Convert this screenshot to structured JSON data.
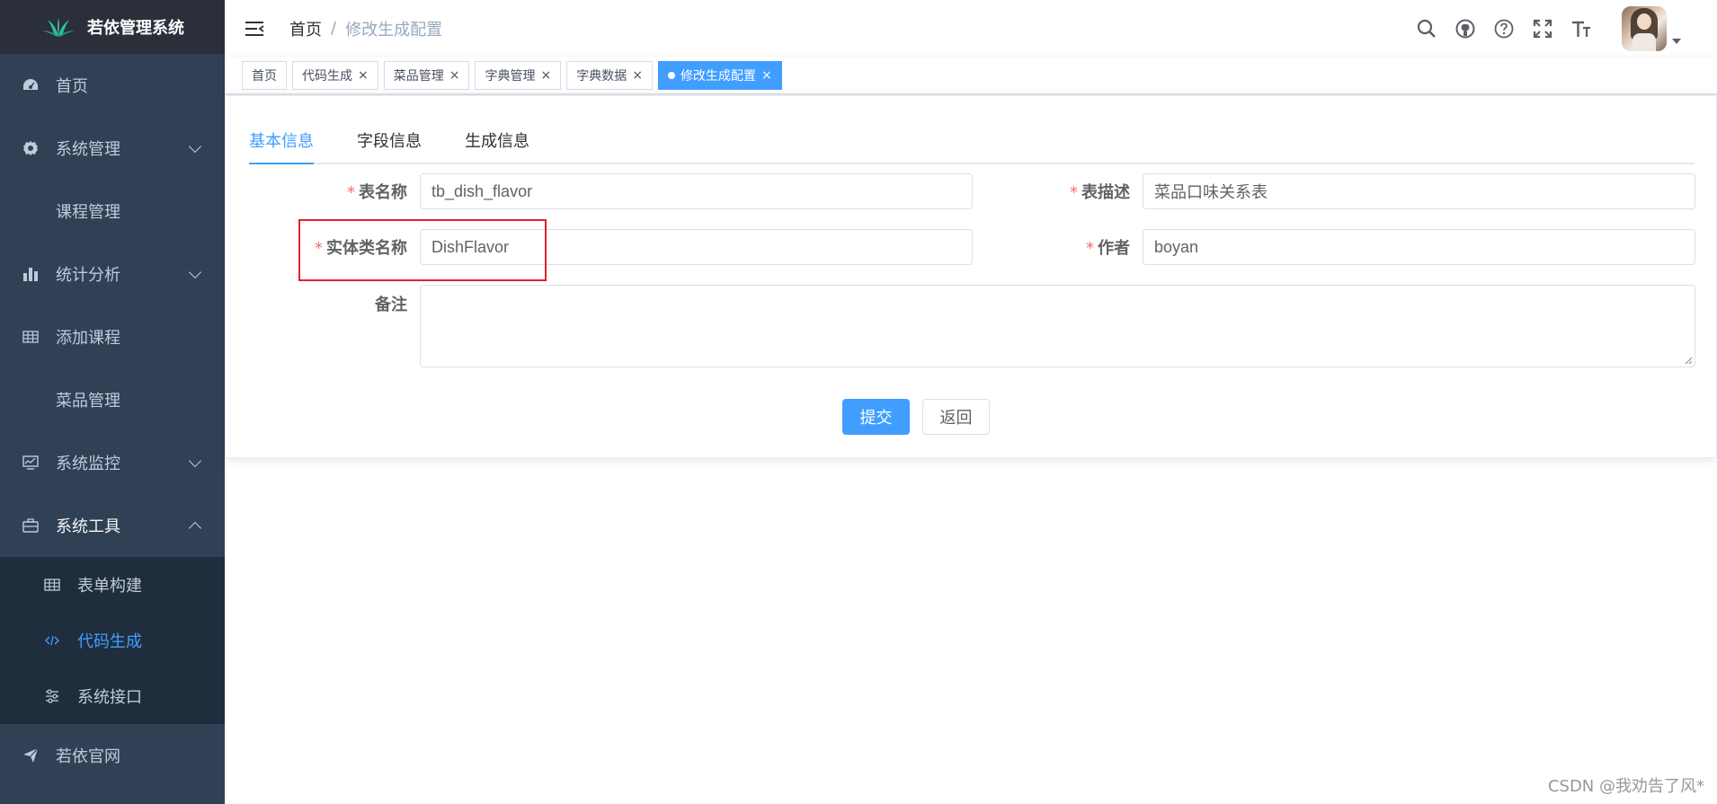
{
  "app": {
    "title": "若依管理系统"
  },
  "sidebar": {
    "items": [
      {
        "label": "首页",
        "icon": "dashboard-icon"
      },
      {
        "label": "系统管理",
        "icon": "gear-icon"
      },
      {
        "label": "课程管理"
      },
      {
        "label": "统计分析",
        "icon": "bar-chart-icon"
      },
      {
        "label": "添加课程",
        "icon": "table-icon"
      },
      {
        "label": "菜品管理"
      },
      {
        "label": "系统监控",
        "icon": "monitor-icon"
      },
      {
        "label": "系统工具",
        "icon": "toolbox-icon"
      }
    ],
    "submenu": [
      {
        "label": "表单构建",
        "icon": "table-icon"
      },
      {
        "label": "代码生成",
        "icon": "code-icon"
      },
      {
        "label": "系统接口",
        "icon": "sliders-icon"
      }
    ],
    "last": {
      "label": "若依官网",
      "icon": "send-icon"
    }
  },
  "breadcrumb": {
    "home": "首页",
    "separator": "/",
    "current": "修改生成配置"
  },
  "tags": [
    {
      "label": "首页"
    },
    {
      "label": "代码生成"
    },
    {
      "label": "菜品管理"
    },
    {
      "label": "字典管理"
    },
    {
      "label": "字典数据"
    },
    {
      "label": "修改生成配置"
    }
  ],
  "tags_close": "×",
  "tabs": [
    "基本信息",
    "字段信息",
    "生成信息"
  ],
  "form": {
    "required_mark": "*",
    "table_name_label": "表名称",
    "table_name_value": "tb_dish_flavor",
    "table_desc_label": "表描述",
    "table_desc_value": "菜品口味关系表",
    "class_name_label": "实体类名称",
    "class_name_value": "DishFlavor",
    "author_label": "作者",
    "author_value": "boyan",
    "remark_label": "备注",
    "remark_value": ""
  },
  "buttons": {
    "submit": "提交",
    "back": "返回"
  },
  "watermark": "CSDN @我劝告了风*",
  "colors": {
    "primary": "#409eff",
    "sidebar": "#304156",
    "highlight": "#e0212b"
  }
}
